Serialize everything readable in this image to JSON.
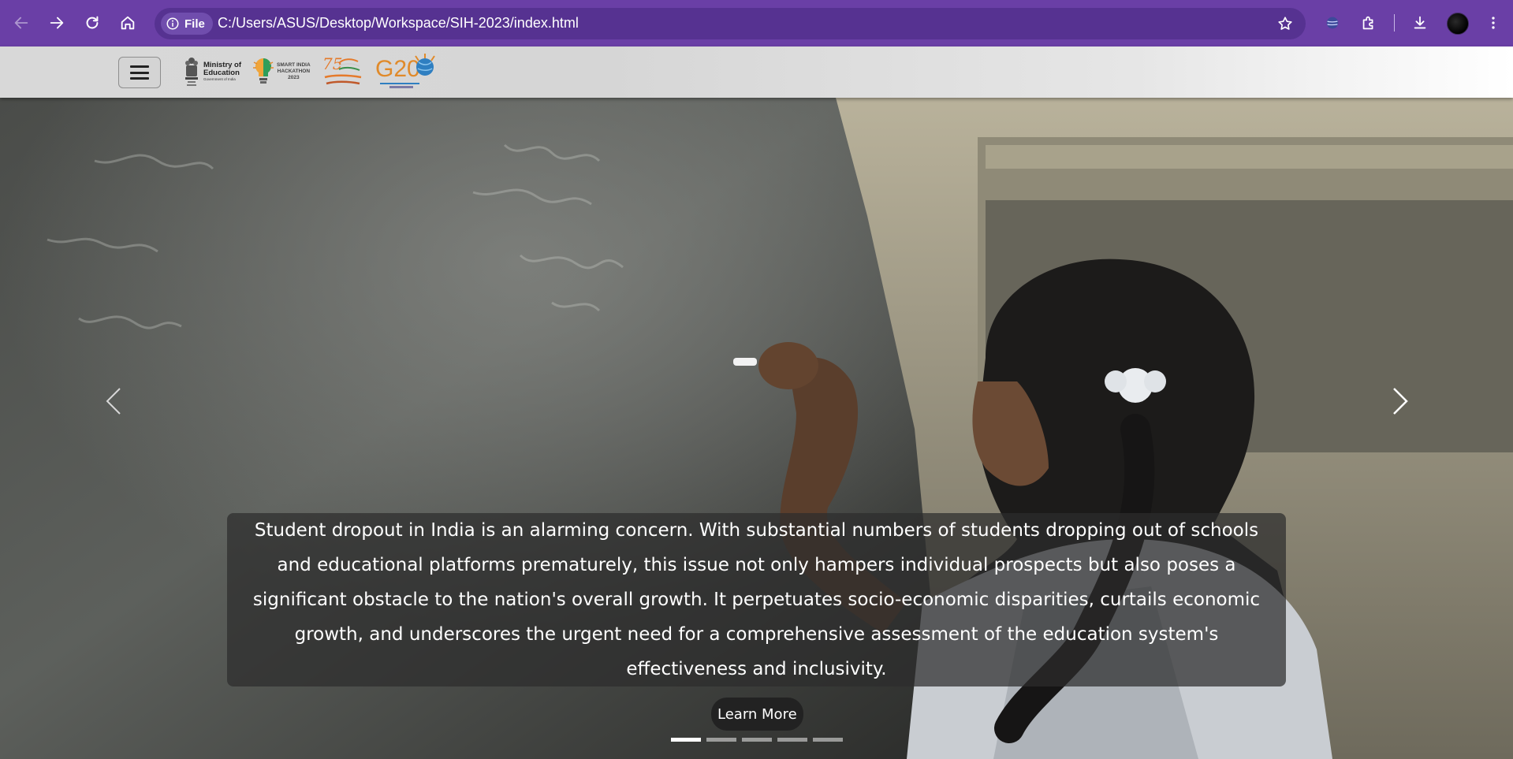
{
  "browser": {
    "site_chip_label": "File",
    "url": "C:/Users/ASUS/Desktop/Workspace/SIH-2023/index.html",
    "accent_color": "#6a3fa6",
    "icons": [
      "back-icon",
      "forward-icon",
      "reload-icon",
      "home-icon",
      "info-icon",
      "star-icon",
      "extension-puzzle-icon",
      "downloads-icon",
      "kebab-menu-icon"
    ]
  },
  "header": {
    "logos": {
      "moe_line1": "Ministry of",
      "moe_line2": "Education",
      "moe_line3": "Government of India",
      "sih_line1": "SMART INDIA",
      "sih_line2": "HACKATHON",
      "sih_line3": "2023",
      "g20_label": "G20"
    }
  },
  "hero": {
    "caption": "Student dropout in India is an alarming concern. With substantial numbers of students dropping out of schools and educational platforms prematurely, this issue not only hampers individual prospects but also poses a significant obstacle to the nation's overall growth. It perpetuates socio-economic disparities, curtails economic growth, and underscores the urgent need for a comprehensive assessment of the education system's effectiveness and inclusivity.",
    "cta_label": "Learn More",
    "slide_count": 5,
    "active_slide": 1
  }
}
